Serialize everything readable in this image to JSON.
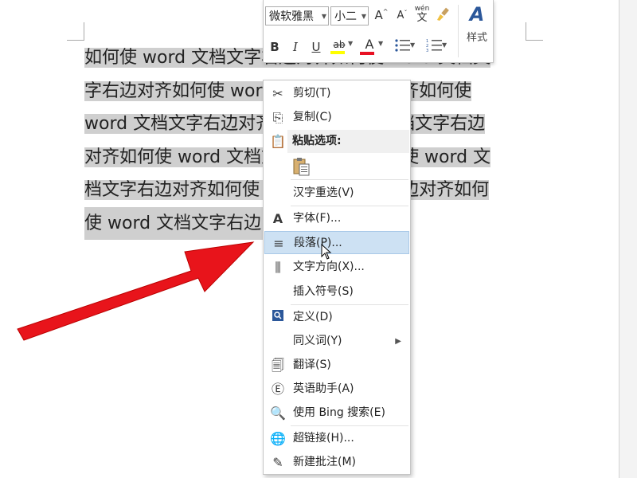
{
  "document": {
    "lines": [
      "如何使 word 文档文字右边对齐如何使 word 文档文",
      "字右边对齐如何使 word 文档文字右边对齐如何使",
      "word 文档文字右边对齐如何使 word 文档文字右边",
      "对齐如何使 word 文档文字右边对齐如何使 word 文",
      "档文字右边对齐如何使 word 文档文字右边对齐如何",
      "使 word 文档文字右边"
    ]
  },
  "mini_toolbar": {
    "font_name": "微软雅黑",
    "font_size": "小二",
    "grow_font": "A",
    "shrink_font": "A",
    "phonetic_top": "wén",
    "phonetic_bottom": "文",
    "bold": "B",
    "italic": "I",
    "underline": "U",
    "highlight": "ab",
    "font_color": "A",
    "styles_label": "样式",
    "highlight_color": "#ffff00",
    "font_color_value": "#e81123"
  },
  "context_menu": {
    "items": [
      {
        "label": "剪切(T)",
        "icon": "scissors-icon"
      },
      {
        "label": "复制(C)",
        "icon": "copy-icon"
      },
      {
        "label": "粘贴选项:",
        "icon": "paste-icon"
      },
      {
        "label": "汉字重选(V)",
        "icon": ""
      },
      {
        "label": "字体(F)...",
        "icon": "font-icon"
      },
      {
        "label": "段落(P)...",
        "icon": "paragraph-icon"
      },
      {
        "label": "文字方向(X)...",
        "icon": "text-direction-icon"
      },
      {
        "label": "插入符号(S)",
        "icon": ""
      },
      {
        "label": "定义(D)",
        "icon": "define-icon"
      },
      {
        "label": "同义词(Y)",
        "icon": ""
      },
      {
        "label": "翻译(S)",
        "icon": "translate-icon"
      },
      {
        "label": "英语助手(A)",
        "icon": "english-assistant-icon"
      },
      {
        "label": "使用 Bing 搜索(E)",
        "icon": "bing-search-icon"
      },
      {
        "label": "超链接(H)...",
        "icon": "hyperlink-icon"
      },
      {
        "label": "新建批注(M)",
        "icon": "new-comment-icon"
      }
    ],
    "hover_color": "#cde1f3"
  },
  "annotation": {
    "arrow_color": "#e8141b"
  }
}
